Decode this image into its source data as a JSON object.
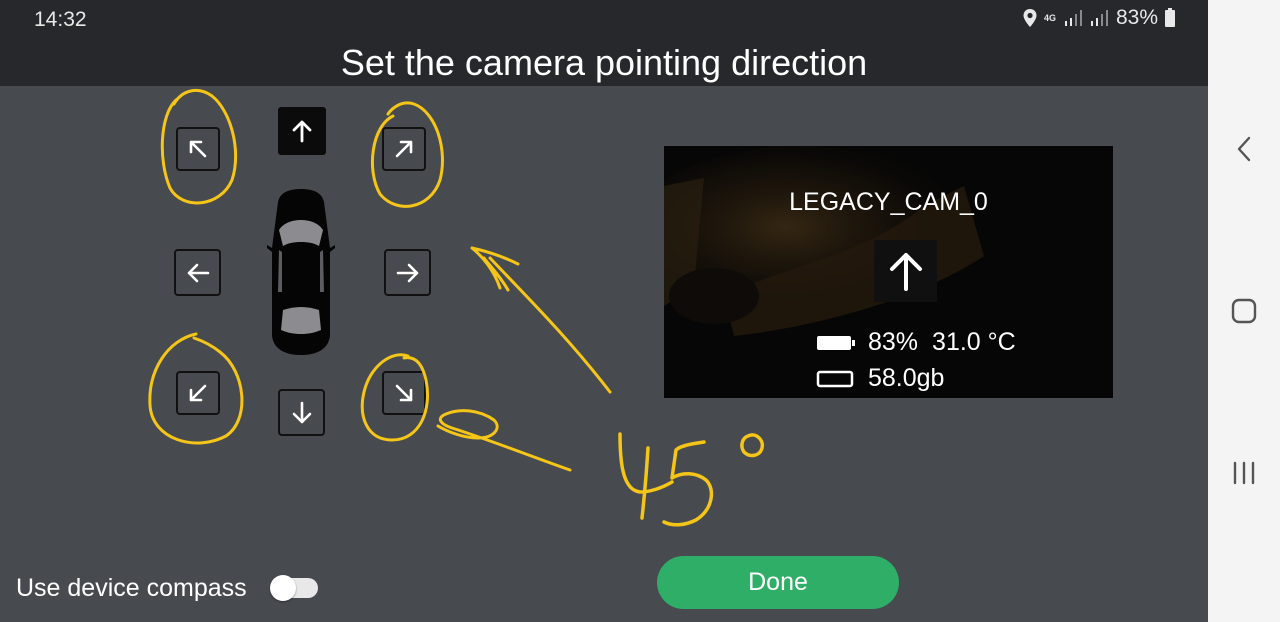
{
  "status_bar": {
    "time": "14:32",
    "network": "4G",
    "battery": "83%"
  },
  "page": {
    "title": "Set the camera pointing direction"
  },
  "direction_pad": {
    "selected": "up",
    "buttons": [
      "up-left",
      "up",
      "up-right",
      "left",
      "right",
      "down-left",
      "down",
      "down-right"
    ]
  },
  "camera": {
    "name": "LEGACY_CAM_0",
    "battery": "83%",
    "temperature": "31.0 °C",
    "storage": "58.0gb"
  },
  "annotation": {
    "text": "45°",
    "color": "#f5c518"
  },
  "controls": {
    "compass_label": "Use device compass",
    "compass_enabled": false,
    "done_label": "Done"
  },
  "colors": {
    "background": "#474a4f",
    "header": "#27282b",
    "accent": "#2fae67"
  },
  "nav_icons": [
    "back-icon",
    "home-icon",
    "recents-icon"
  ]
}
